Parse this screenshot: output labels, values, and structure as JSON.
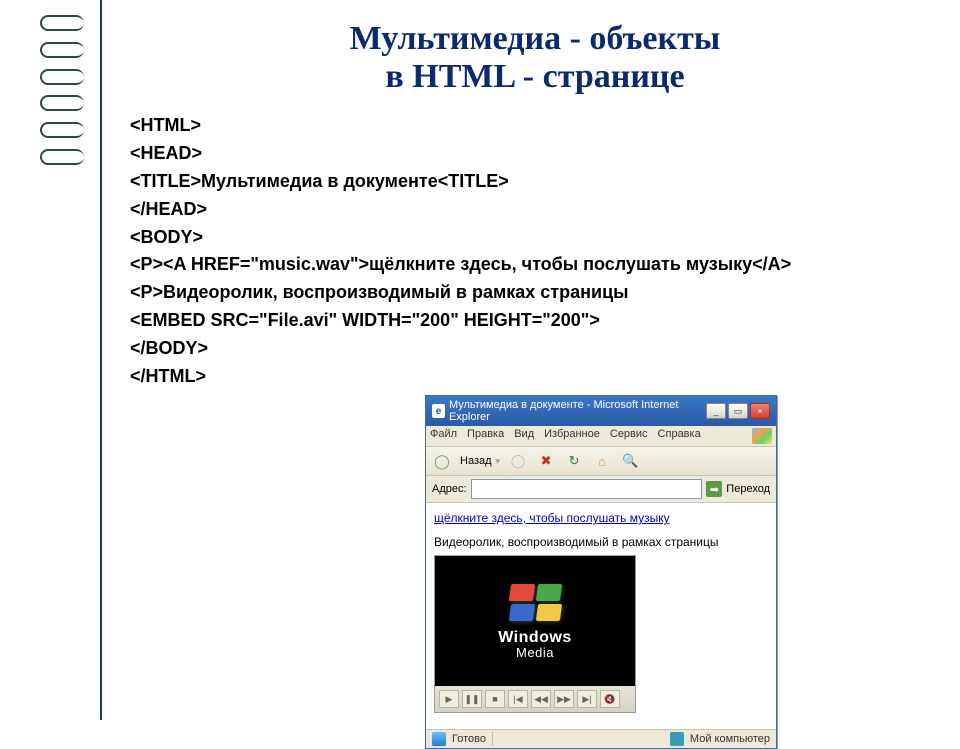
{
  "slide": {
    "title_line1": "Мультимедиа - объекты",
    "title_line2": "в HTML - странице"
  },
  "code": {
    "l1": "<HTML>",
    "l2": "<HEAD>",
    "l3": "<TITLE>Мультимедиа в документе<TITLE>",
    "l4": "</HEAD>",
    "l5": "<BODY>",
    "l6": "<P><A HREF=\"music.wav\">щёлкните здесь, чтобы послушать музыку</A>",
    "l7": "<P>Видеоролик, воспроизводимый в рамках страницы",
    "l8": "<EMBED SRC=\"File.avi\" WIDTH=\"200\" HEIGHT=\"200\">",
    "l9": "</BODY>",
    "l10": "</HTML>"
  },
  "ie": {
    "title": "Мультимедиа в документе - Microsoft Internet Explorer",
    "menu": {
      "file": "Файл",
      "edit": "Правка",
      "view": "Вид",
      "fav": "Избранное",
      "tools": "Сервис",
      "help": "Справка"
    },
    "toolbar": {
      "back": "Назад"
    },
    "address_label": "Адрес:",
    "go_label": "Переход",
    "page": {
      "link": "щёлкните здесь, чтобы послушать музыку",
      "text": "Видеоролик, воспроизводимый в рамках страницы",
      "wm_brand": "Windows",
      "wm_sub": "Media"
    },
    "status": {
      "ready": "Готово",
      "zone": "Мой компьютер"
    }
  }
}
